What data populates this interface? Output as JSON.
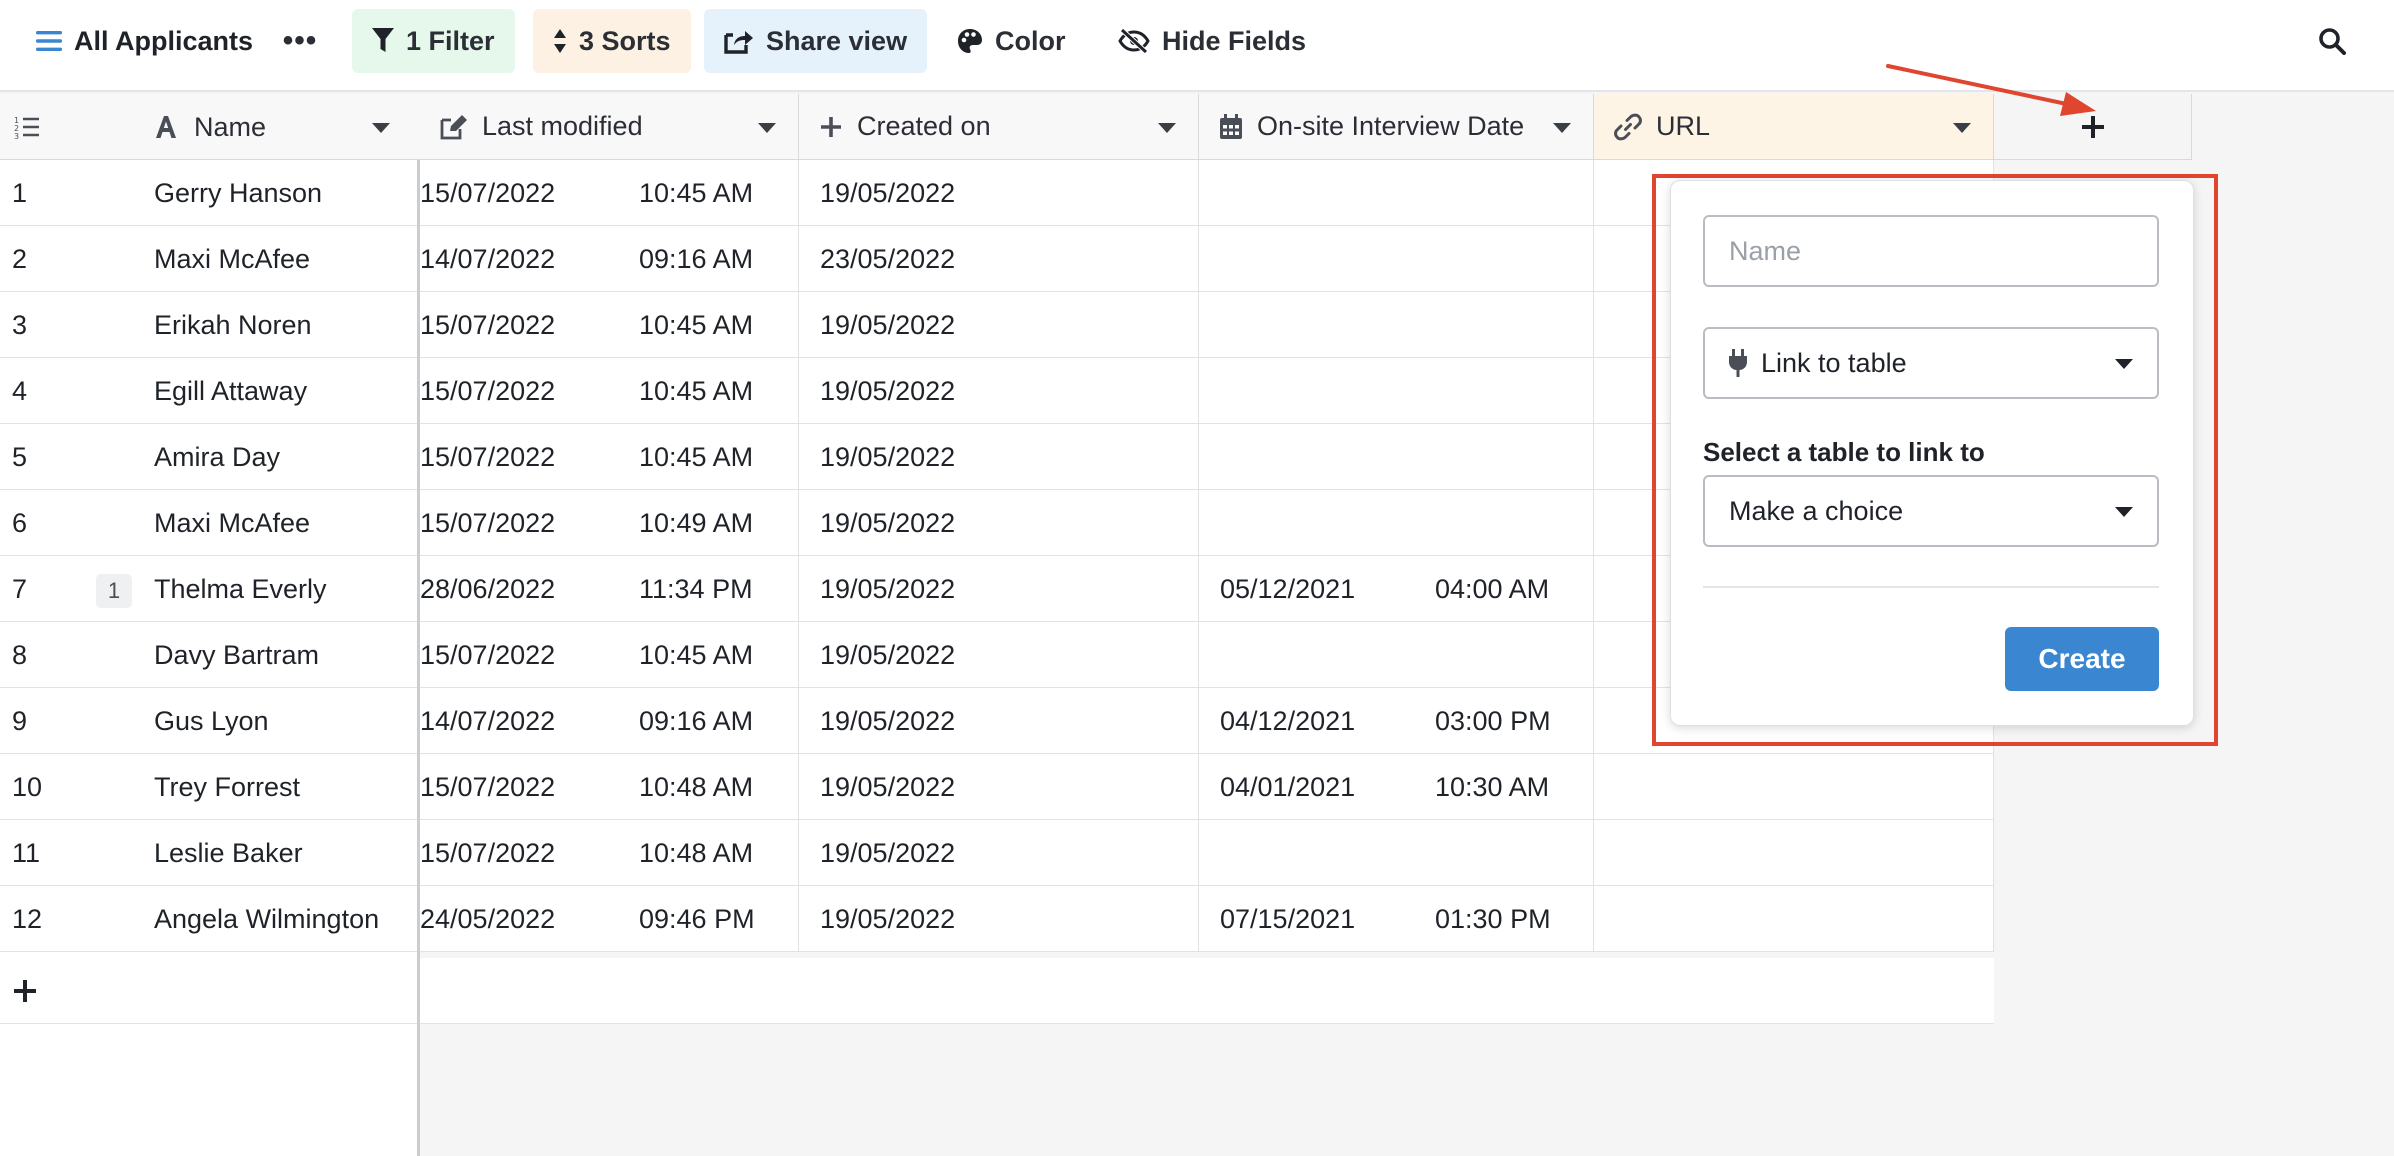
{
  "toolbar": {
    "view_name": "All Applicants",
    "more": "•••",
    "filter": "1 Filter",
    "sorts": "3 Sorts",
    "share": "Share view",
    "color": "Color",
    "hide": "Hide Fields"
  },
  "columns": {
    "name": "Name",
    "last_modified": "Last modified",
    "created_on": "Created on",
    "interview": "On-site Interview Date",
    "url": "URL"
  },
  "rows": [
    {
      "id": "1",
      "name": "Gerry Hanson",
      "lm_date": "15/07/2022",
      "lm_time": "10:45 AM",
      "created": "19/05/2022",
      "iv_date": "",
      "iv_time": "",
      "badge": ""
    },
    {
      "id": "2",
      "name": "Maxi McAfee",
      "lm_date": "14/07/2022",
      "lm_time": "09:16 AM",
      "created": "23/05/2022",
      "iv_date": "",
      "iv_time": "",
      "badge": ""
    },
    {
      "id": "3",
      "name": "Erikah Noren",
      "lm_date": "15/07/2022",
      "lm_time": "10:45 AM",
      "created": "19/05/2022",
      "iv_date": "",
      "iv_time": "",
      "badge": ""
    },
    {
      "id": "4",
      "name": "Egill Attaway",
      "lm_date": "15/07/2022",
      "lm_time": "10:45 AM",
      "created": "19/05/2022",
      "iv_date": "",
      "iv_time": "",
      "badge": ""
    },
    {
      "id": "5",
      "name": "Amira Day",
      "lm_date": "15/07/2022",
      "lm_time": "10:45 AM",
      "created": "19/05/2022",
      "iv_date": "",
      "iv_time": "",
      "badge": ""
    },
    {
      "id": "6",
      "name": "Maxi McAfee",
      "lm_date": "15/07/2022",
      "lm_time": "10:49 AM",
      "created": "19/05/2022",
      "iv_date": "",
      "iv_time": "",
      "badge": ""
    },
    {
      "id": "7",
      "name": "Thelma Everly",
      "lm_date": "28/06/2022",
      "lm_time": "11:34 PM",
      "created": "19/05/2022",
      "iv_date": "05/12/2021",
      "iv_time": "04:00 AM",
      "badge": "1"
    },
    {
      "id": "8",
      "name": "Davy Bartram",
      "lm_date": "15/07/2022",
      "lm_time": "10:45 AM",
      "created": "19/05/2022",
      "iv_date": "",
      "iv_time": "",
      "badge": ""
    },
    {
      "id": "9",
      "name": "Gus Lyon",
      "lm_date": "14/07/2022",
      "lm_time": "09:16 AM",
      "created": "19/05/2022",
      "iv_date": "04/12/2021",
      "iv_time": "03:00 PM",
      "badge": ""
    },
    {
      "id": "10",
      "name": "Trey Forrest",
      "lm_date": "15/07/2022",
      "lm_time": "10:48 AM",
      "created": "19/05/2022",
      "iv_date": "04/01/2021",
      "iv_time": "10:30 AM",
      "badge": ""
    },
    {
      "id": "11",
      "name": "Leslie Baker",
      "lm_date": "15/07/2022",
      "lm_time": "10:48 AM",
      "created": "19/05/2022",
      "iv_date": "",
      "iv_time": "",
      "badge": ""
    },
    {
      "id": "12",
      "name": "Angela Wilmington",
      "lm_date": "24/05/2022",
      "lm_time": "09:46 PM",
      "created": "19/05/2022",
      "iv_date": "07/15/2021",
      "iv_time": "01:30 PM",
      "badge": ""
    }
  ],
  "popup": {
    "name_placeholder": "Name",
    "type_value": "Link to table",
    "table_label": "Select a table to link to",
    "table_value": "Make a choice",
    "create_label": "Create"
  },
  "colors": {
    "accent": "#3b86d1",
    "annotation": "#e0462f",
    "filter_bg": "#e6f7ec",
    "sort_bg": "#fdf1e3",
    "share_bg": "#e6f2fb",
    "url_header_bg": "#fdf4e6"
  },
  "icons": {
    "views": "hamburger-icon",
    "filter": "funnel-icon",
    "sort": "sort-icon",
    "share": "share-icon",
    "color": "palette-icon",
    "hide": "eye-slash-icon",
    "search": "search-icon"
  }
}
